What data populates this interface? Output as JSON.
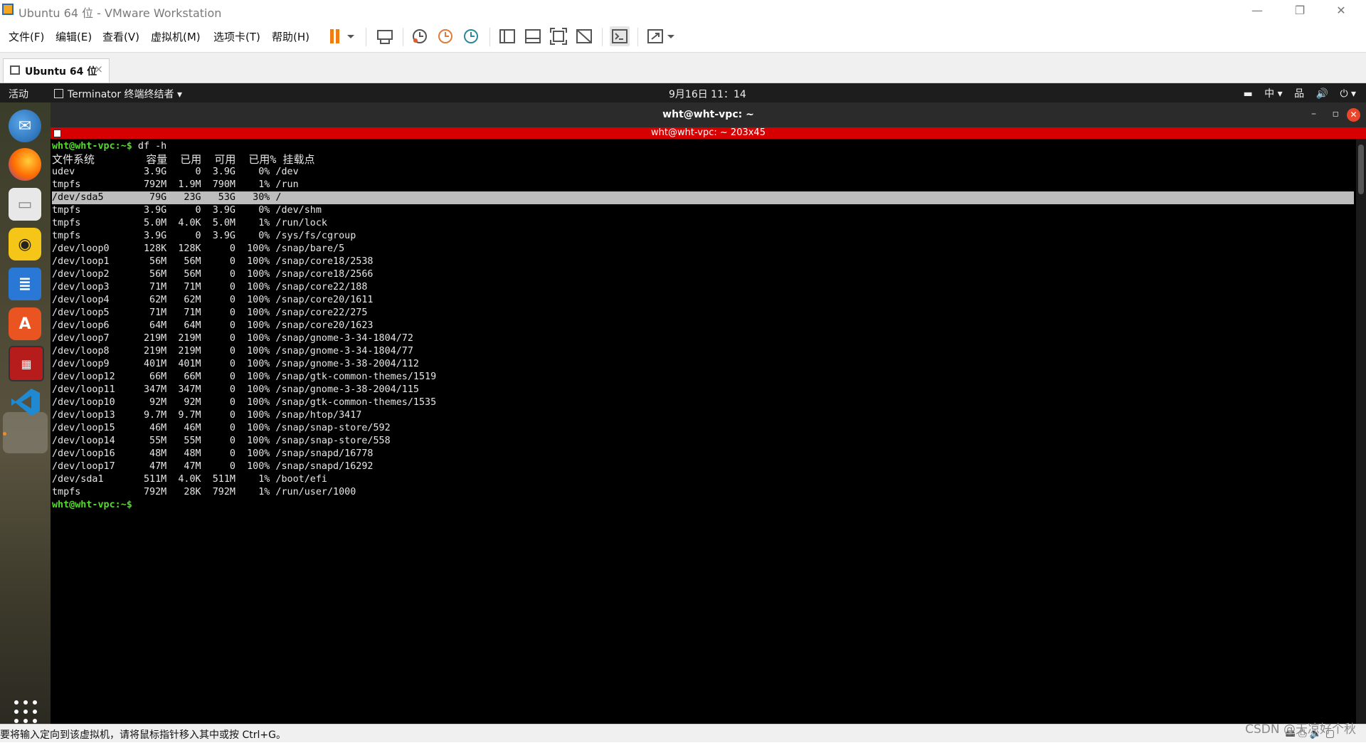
{
  "window": {
    "title": "Ubuntu 64 位 - VMware Workstation",
    "minimize": "—",
    "restore": "❐",
    "close": "✕"
  },
  "menubar": {
    "items": [
      "文件(F)",
      "编辑(E)",
      "查看(V)",
      "虚拟机(M)",
      "选项卡(T)",
      "帮助(H)"
    ]
  },
  "toolbar": {
    "icons": [
      "pause-icon",
      "send-ctrl-alt-del-icon",
      "snapshot-icon",
      "revert-snapshot-icon",
      "snapshot-manager-icon",
      "sidebar-icon",
      "thumbnail-bar-icon",
      "fullscreen-icon",
      "unity-icon",
      "console-view-icon",
      "stretch-icon"
    ]
  },
  "tab": {
    "label": "Ubuntu 64 位",
    "close": "×"
  },
  "gnome": {
    "activities": "活动",
    "app_menu": "Terminator 终端终结者 ▾",
    "clock": "9月16日  11：14",
    "input_method": "中 ▾",
    "tray": [
      "▬",
      "品",
      "🔊",
      "⏻ ▾"
    ]
  },
  "dock": {
    "apps": [
      "thunderbird-icon",
      "firefox-icon",
      "files-icon",
      "rhythmbox-icon",
      "writer-icon",
      "software-center-icon",
      "terminator-icon",
      "vscode-icon"
    ],
    "show_apps": "show-apps-grid-icon"
  },
  "terminal": {
    "window_title": "wht@wht-vpc: ~",
    "tab_title": "wht@wht-vpc: ~ 203x45",
    "command_prompt": "wht@wht-vpc:~$",
    "command": " df -h",
    "header": "文件系统        容量  已用  可用  已用% 挂载点",
    "rows": [
      "udev            3.9G     0  3.9G    0% /dev",
      "tmpfs           792M  1.9M  790M    1% /run",
      "/dev/sda5        79G   23G   53G   30% /",
      "tmpfs           3.9G     0  3.9G    0% /dev/shm",
      "tmpfs           5.0M  4.0K  5.0M    1% /run/lock",
      "tmpfs           3.9G     0  3.9G    0% /sys/fs/cgroup",
      "/dev/loop0      128K  128K     0  100% /snap/bare/5",
      "/dev/loop1       56M   56M     0  100% /snap/core18/2538",
      "/dev/loop2       56M   56M     0  100% /snap/core18/2566",
      "/dev/loop3       71M   71M     0  100% /snap/core22/188",
      "/dev/loop4       62M   62M     0  100% /snap/core20/1611",
      "/dev/loop5       71M   71M     0  100% /snap/core22/275",
      "/dev/loop6       64M   64M     0  100% /snap/core20/1623",
      "/dev/loop7      219M  219M     0  100% /snap/gnome-3-34-1804/72",
      "/dev/loop8      219M  219M     0  100% /snap/gnome-3-34-1804/77",
      "/dev/loop9      401M  401M     0  100% /snap/gnome-3-38-2004/112",
      "/dev/loop12      66M   66M     0  100% /snap/gtk-common-themes/1519",
      "/dev/loop11     347M  347M     0  100% /snap/gnome-3-38-2004/115",
      "/dev/loop10      92M   92M     0  100% /snap/gtk-common-themes/1535",
      "/dev/loop13     9.7M  9.7M     0  100% /snap/htop/3417",
      "/dev/loop15      46M   46M     0  100% /snap/snap-store/592",
      "/dev/loop14      55M   55M     0  100% /snap/snap-store/558",
      "/dev/loop16      48M   48M     0  100% /snap/snapd/16778",
      "/dev/loop17      47M   47M     0  100% /snap/snapd/16292",
      "/dev/sda1       511M  4.0K  511M    1% /boot/efi",
      "tmpfs           792M   28K  792M    1% /run/user/1000"
    ],
    "selected_row_index": 2,
    "final_prompt": "wht@wht-vpc:~$"
  },
  "statusbar": {
    "message": "要将输入定向到该虚拟机，请将鼠标指针移入其中或按 Ctrl+G。",
    "watermark": "CSDN @天凉好个秋"
  }
}
